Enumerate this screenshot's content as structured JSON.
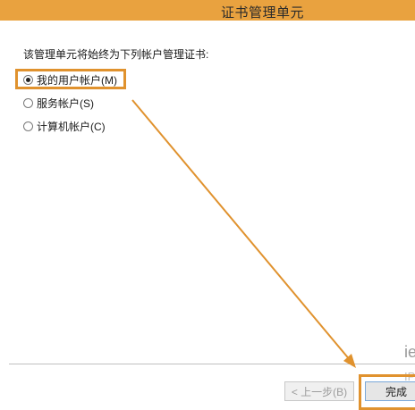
{
  "window": {
    "title": "证书管理单元"
  },
  "prompt": "该管理单元将始终为下列帐户管理证书:",
  "options": [
    {
      "label": "我的用户帐户(M)",
      "checked": true
    },
    {
      "label": "服务帐户(S)",
      "checked": false
    },
    {
      "label": "计算机帐户(C)",
      "checked": false
    }
  ],
  "side": {
    "text1": "ie",
    "text2": "IP"
  },
  "buttons": {
    "back": "< 上一步(B)",
    "finish": "完成"
  },
  "colors": {
    "highlight": "#e0922e",
    "titlebar": "#e9a23f"
  }
}
